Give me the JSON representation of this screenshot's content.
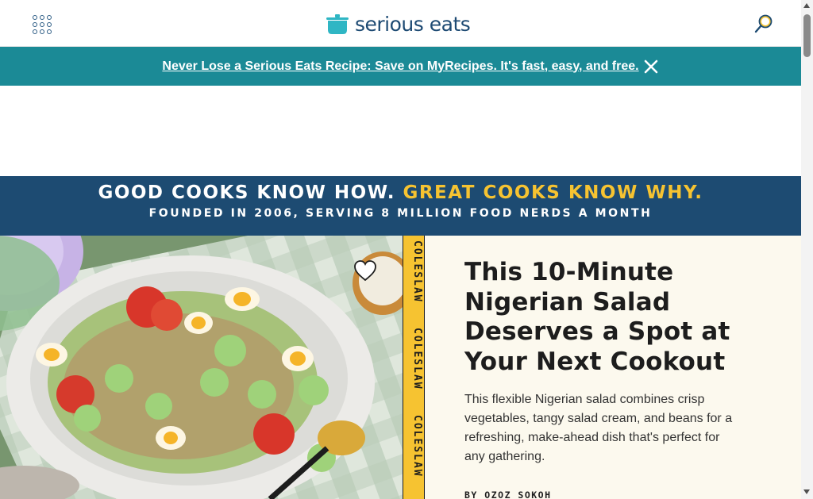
{
  "header": {
    "menu_icon": "grid-menu-icon",
    "logo_icon": "pot-icon",
    "logo_text": "serious eats",
    "search_icon": "magnifier-icon"
  },
  "promo": {
    "text": "Never Lose a Serious Eats Recipe: Save on MyRecipes. It's fast, easy, and free.",
    "close_icon": "close-icon"
  },
  "tagline": {
    "part1": "GOOD COOKS KNOW HOW.",
    "part2": "GREAT COOKS KNOW WHY.",
    "sub": "FOUNDED IN 2006, SERVING 8 MILLION FOOD NERDS A MONTH"
  },
  "hero": {
    "save_icon": "heart-icon",
    "tags": [
      "COLESLAW",
      "COLESLAW",
      "COLESLAW"
    ],
    "headline": "This 10-Minute Nigerian Salad Deserves a Spot at Your Next Cookout",
    "description": "This flexible Nigerian salad combines crisp vegetables, tangy salad cream, and beans for a refreshing, make-ahead dish that's perfect for any gathering.",
    "byline_prefix": "BY",
    "author": "OZOZ SOKOH"
  },
  "colors": {
    "brand_navy": "#1d4b72",
    "promo_teal": "#1b8a96",
    "accent_yellow": "#f6c331",
    "hero_text_bg": "#fcf9ee"
  }
}
